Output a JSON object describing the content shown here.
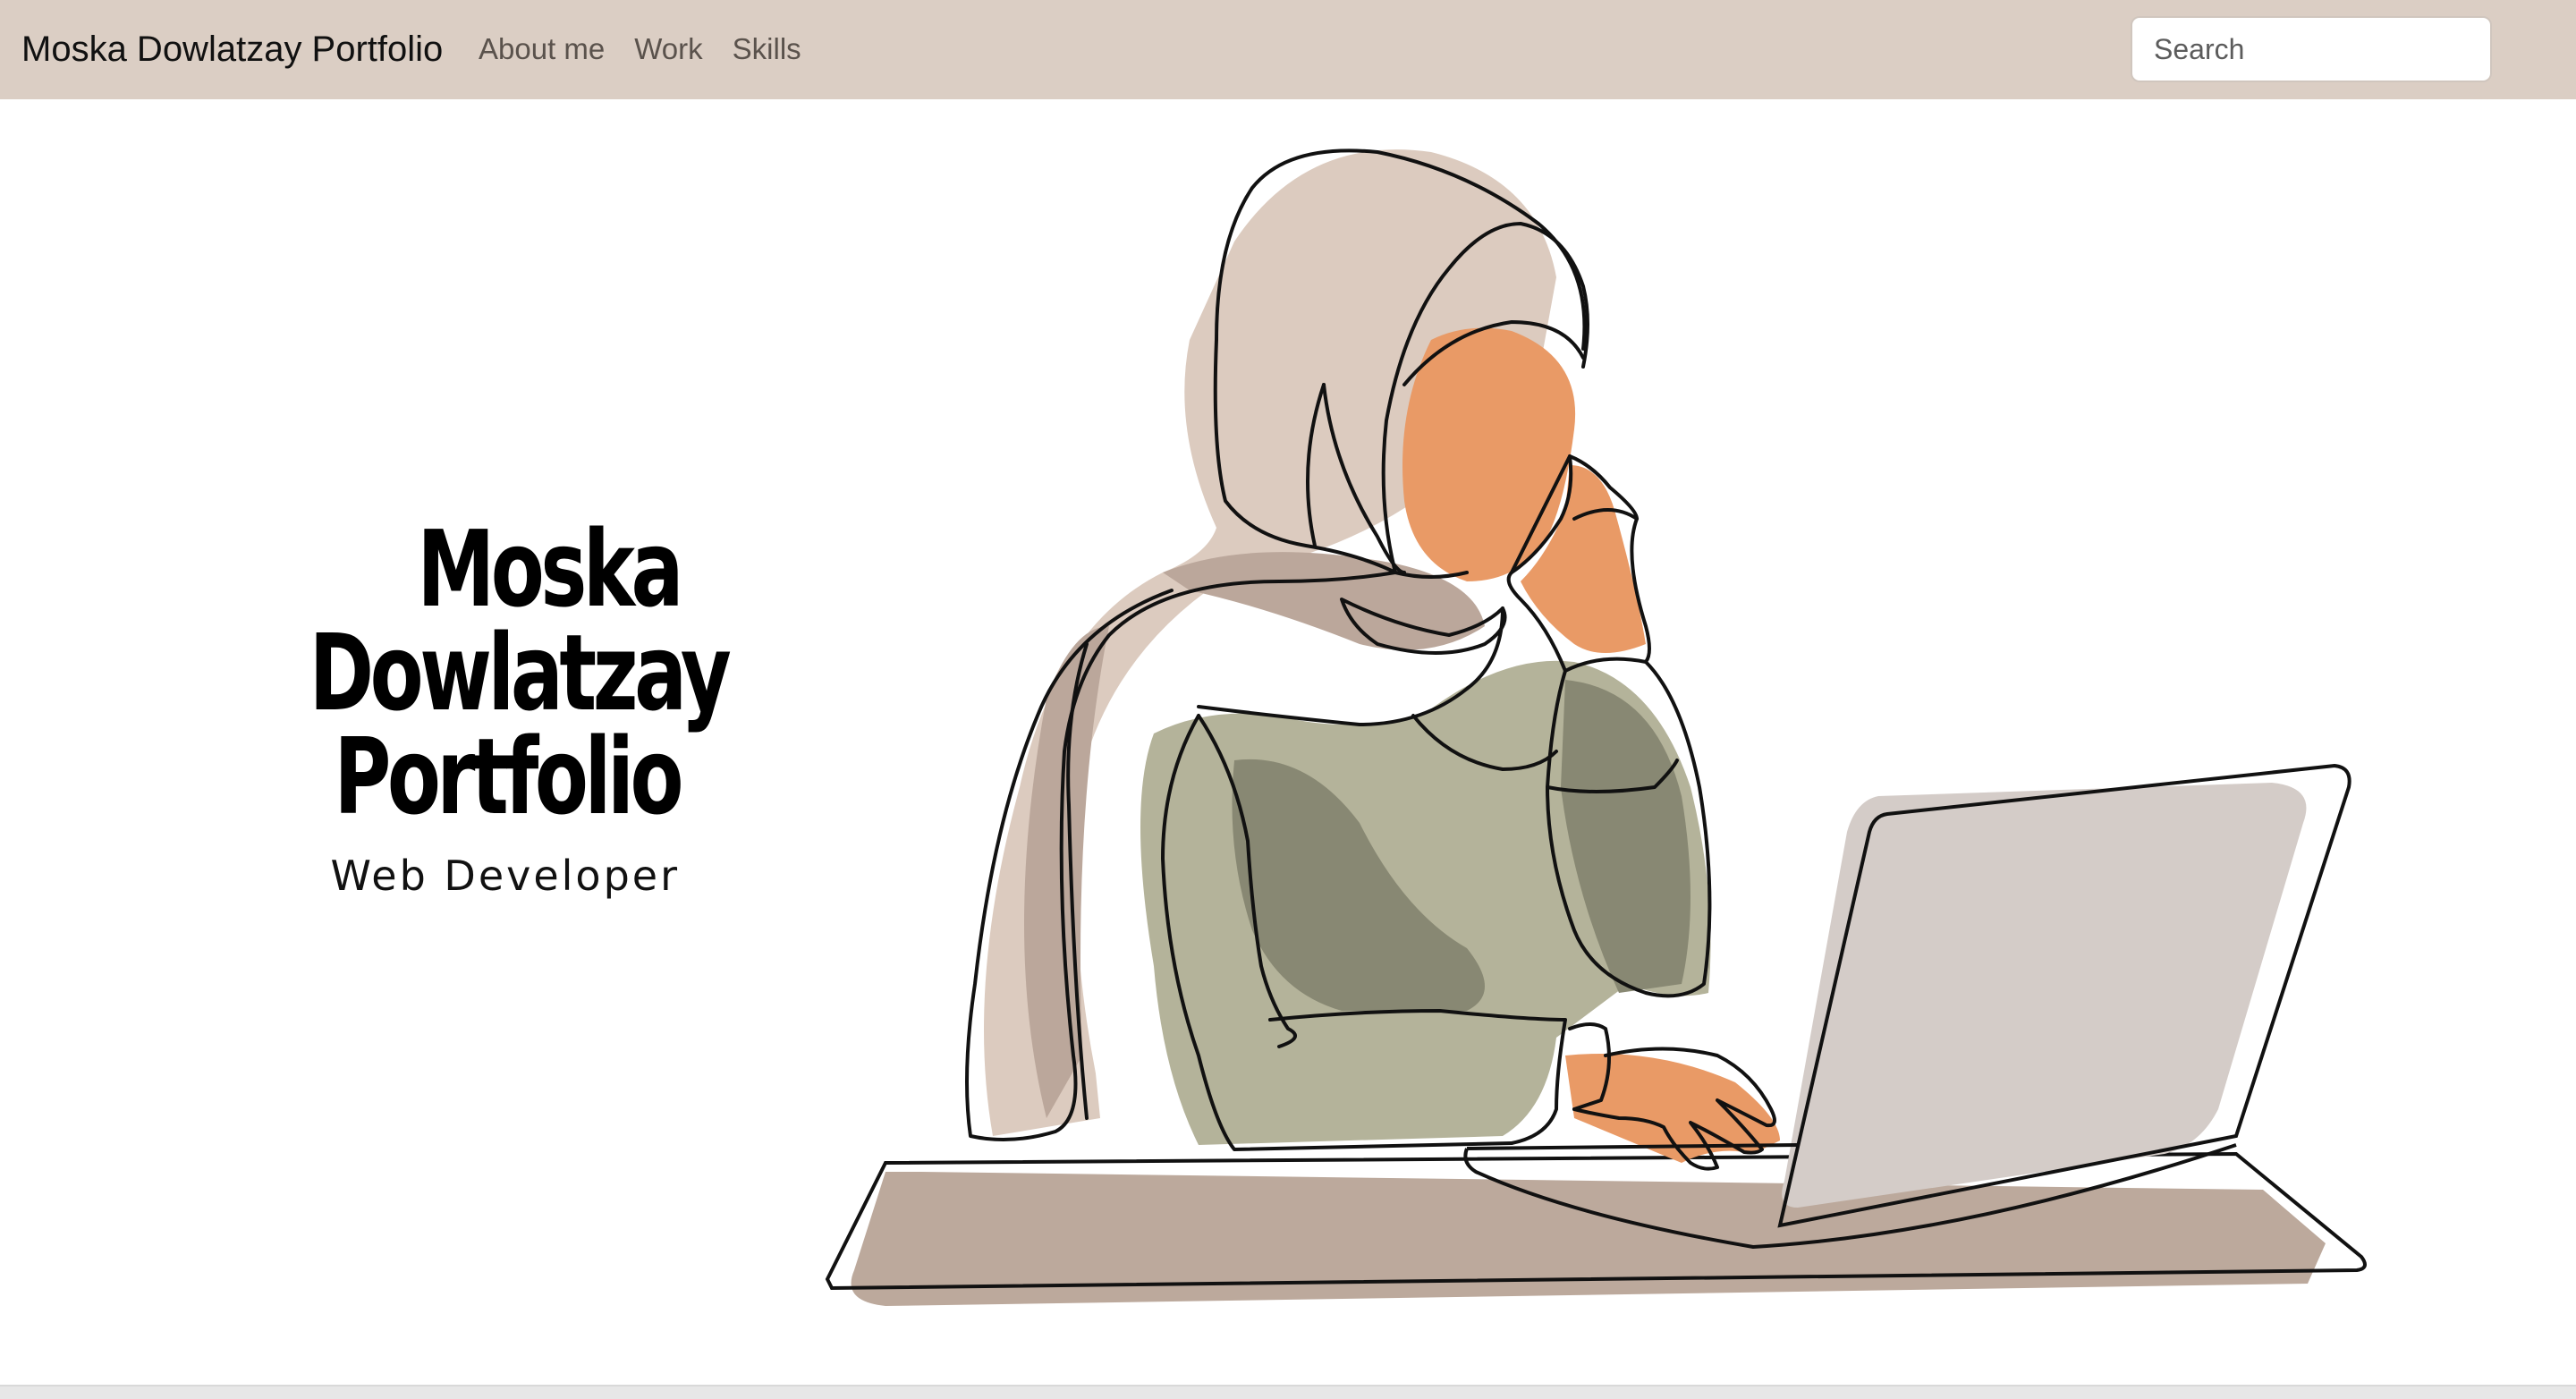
{
  "navbar": {
    "brand": "Moska Dowlatzay Portfolio",
    "links": [
      {
        "label": "About me"
      },
      {
        "label": "Work"
      },
      {
        "label": "Skills"
      }
    ],
    "search": {
      "placeholder": "Search",
      "value": ""
    }
  },
  "hero": {
    "title_lines": [
      "Moska",
      "Dowlatzay",
      "Portfolio"
    ],
    "subtitle": "Web Developer"
  },
  "colors": {
    "navbar_bg": "#dbcec4",
    "hijab": "#dccbbf",
    "hijab_shadow": "#bba79b",
    "skin": "#e99a66",
    "sweater": "#b4b39a",
    "sweater_shadow": "#888873",
    "laptop": "#d4ccc8",
    "desk": "#bca99c"
  },
  "illustration": {
    "icon": "woman-with-laptop-illustration"
  }
}
